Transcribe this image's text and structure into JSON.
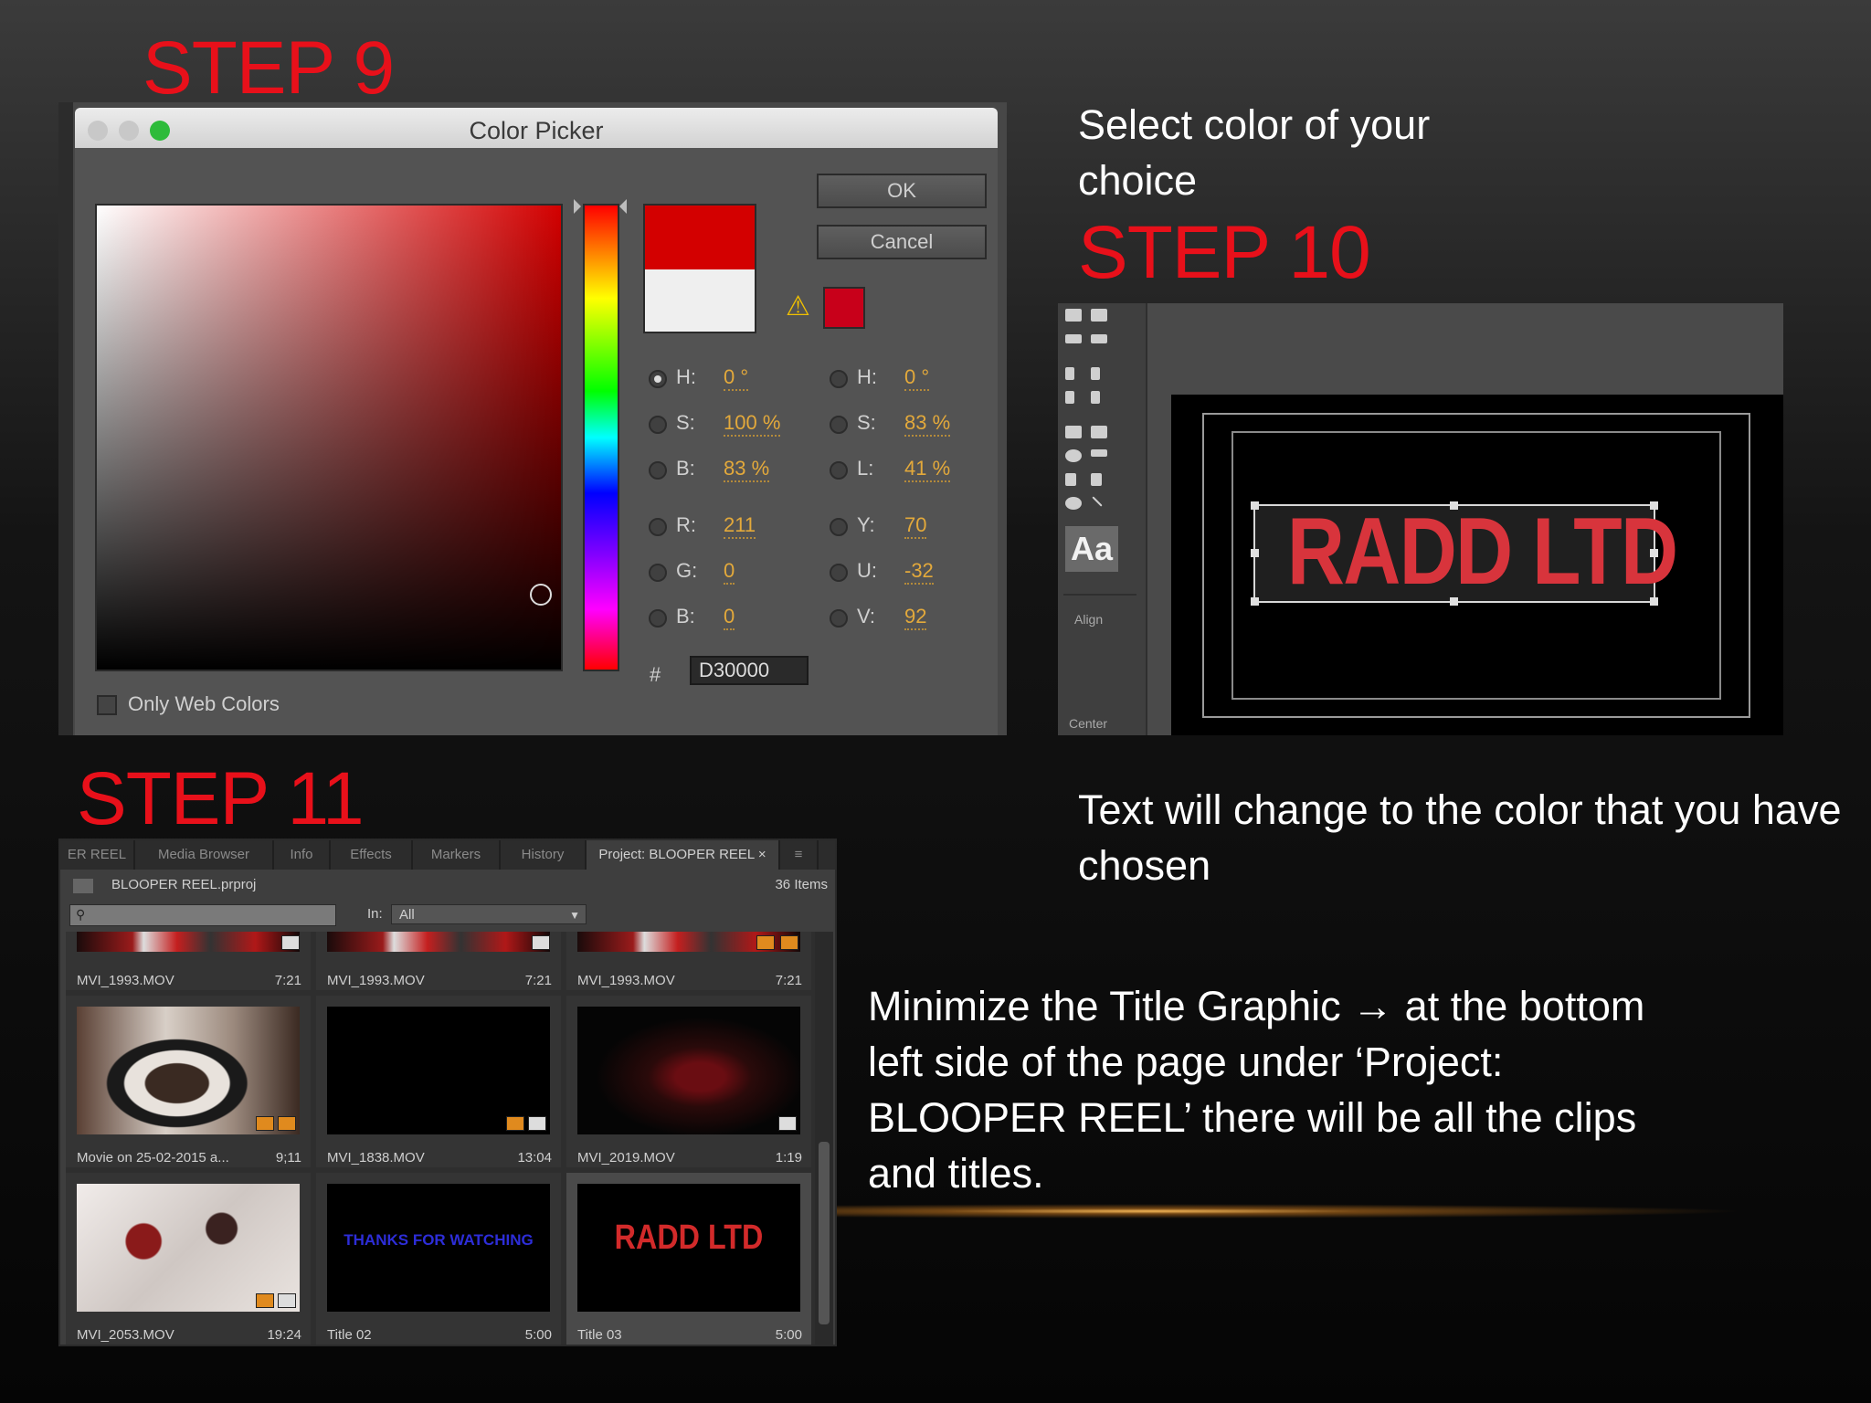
{
  "steps": {
    "step9": "STEP 9",
    "step10": "STEP 10",
    "step11": "STEP 11"
  },
  "descriptions": {
    "select_color": [
      "Select color of your",
      "choice"
    ],
    "text_change": [
      "Text will change to the color that you have",
      "chosen"
    ],
    "minimize": [
      "Minimize the Title Graphic → at the bottom",
      "left side of the page under ‘Project:",
      "BLOOPER REEL’ there will be all the clips",
      "and titles."
    ]
  },
  "color_picker": {
    "title": "Color Picker",
    "ok_label": "OK",
    "cancel_label": "Cancel",
    "only_web_colors": "Only Web Colors",
    "hex_label": "#",
    "hex_value": "D30000",
    "selected_color": "#d30000",
    "left_fields": [
      {
        "label": "H:",
        "value": "0",
        "unit": "°",
        "selected": true
      },
      {
        "label": "S:",
        "value": "100",
        "unit": "%",
        "selected": false
      },
      {
        "label": "B:",
        "value": "83",
        "unit": "%",
        "selected": false
      },
      {
        "label": "R:",
        "value": "211",
        "unit": "",
        "selected": false
      },
      {
        "label": "G:",
        "value": "0",
        "unit": "",
        "selected": false
      },
      {
        "label": "B:",
        "value": "0",
        "unit": "",
        "selected": false
      }
    ],
    "right_fields": [
      {
        "label": "H:",
        "value": "0",
        "unit": "°"
      },
      {
        "label": "S:",
        "value": "83",
        "unit": "%"
      },
      {
        "label": "L:",
        "value": "41",
        "unit": "%"
      },
      {
        "label": "Y:",
        "value": "70",
        "unit": ""
      },
      {
        "label": "U:",
        "value": "-32",
        "unit": ""
      },
      {
        "label": "V:",
        "value": "92",
        "unit": ""
      }
    ]
  },
  "title_editor": {
    "aa_label": "Aa",
    "align_label": "Align",
    "center_label": "Center",
    "title_text": "RADD LTD",
    "text_color": "#d8343c"
  },
  "project_panel": {
    "tabs": [
      "ER REEL",
      "Media Browser",
      "Info",
      "Effects",
      "Markers",
      "History",
      "Project: BLOOPER REEL ×"
    ],
    "file_name": "BLOOPER REEL.prproj",
    "item_count": "36 Items",
    "in_label": "In:",
    "in_value": "All",
    "items": [
      {
        "name": "MVI_1993.MOV",
        "duration": "7:21"
      },
      {
        "name": "MVI_1993.MOV",
        "duration": "7:21"
      },
      {
        "name": "MVI_1993.MOV",
        "duration": "7:21"
      },
      {
        "name": "Movie on 25-02-2015 a...",
        "duration": "9;11"
      },
      {
        "name": "MVI_1838.MOV",
        "duration": "13:04"
      },
      {
        "name": "MVI_2019.MOV",
        "duration": "1:19"
      },
      {
        "name": "MVI_2053.MOV",
        "duration": "19:24"
      },
      {
        "name": "Title 02",
        "duration": "5:00",
        "thumb_text": "THANKS FOR WATCHING"
      },
      {
        "name": "Title 03",
        "duration": "5:00",
        "thumb_text": "RADD LTD"
      }
    ]
  }
}
